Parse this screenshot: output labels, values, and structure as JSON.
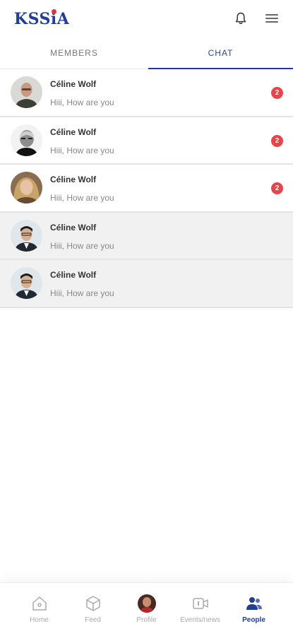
{
  "header": {
    "logo_text_left": "KSS",
    "logo_text_i": "i",
    "logo_text_right": "A",
    "logo_dot_color": "#e3343a",
    "brand_color": "#1f3f95",
    "bell_icon": "bell-icon",
    "menu_icon": "hamburger-menu-icon"
  },
  "tabs": {
    "members_label": "MEMBERS",
    "chat_label": "CHAT",
    "active": "CHAT"
  },
  "chats": [
    {
      "name": "Céline Wolf",
      "message": "Hiii, How are you",
      "unread": "2",
      "read": false
    },
    {
      "name": "Céline Wolf",
      "message": "Hiii, How are you",
      "unread": "2",
      "read": false
    },
    {
      "name": "Céline Wolf",
      "message": "Hiii, How are you",
      "unread": "2",
      "read": false
    },
    {
      "name": "Céline Wolf",
      "message": "Hiii, How are you",
      "unread": "",
      "read": true
    },
    {
      "name": "Céline Wolf",
      "message": "Hiii, How are you",
      "unread": "",
      "read": true
    }
  ],
  "badge_color": "#e8454b",
  "nav": {
    "items": [
      {
        "label": "Home",
        "icon": "home-icon"
      },
      {
        "label": "Feed",
        "icon": "cube-icon"
      },
      {
        "label": "Profile",
        "icon": "profile-avatar"
      },
      {
        "label": "Events/news",
        "icon": "video-camera-icon"
      },
      {
        "label": "People",
        "icon": "people-icon",
        "active": true
      }
    ]
  }
}
